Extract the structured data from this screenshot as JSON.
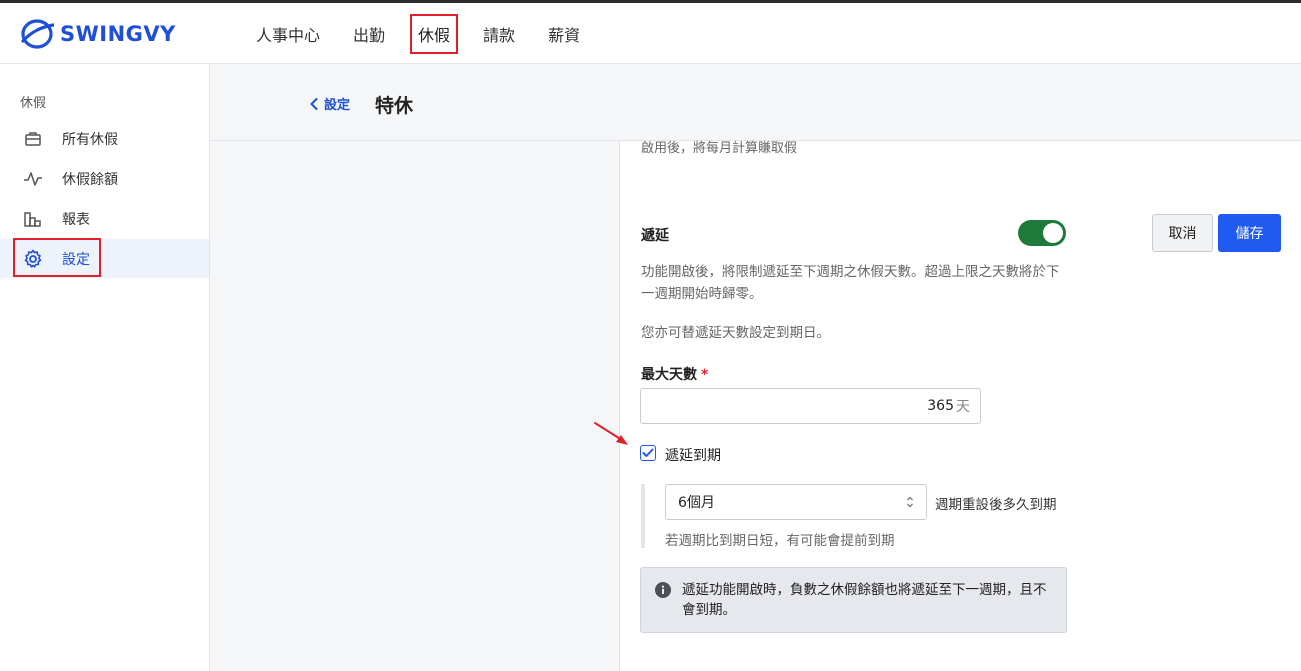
{
  "brand": {
    "name": "SWINGVY"
  },
  "nav": {
    "items": [
      {
        "label": "人事中心"
      },
      {
        "label": "出勤"
      },
      {
        "label": "休假",
        "active": true
      },
      {
        "label": "請款"
      },
      {
        "label": "薪資"
      }
    ]
  },
  "sidebar": {
    "title": "休假",
    "items": [
      {
        "label": "所有休假",
        "icon": "briefcase-icon"
      },
      {
        "label": "休假餘額",
        "icon": "activity-icon"
      },
      {
        "label": "報表",
        "icon": "bar-chart-icon"
      },
      {
        "label": "設定",
        "icon": "gear-icon",
        "active": true
      }
    ]
  },
  "header": {
    "back_label": "設定",
    "title": "特休"
  },
  "panel": {
    "cut_text": "啟用後，將每月計算賺取假",
    "carryover": {
      "label": "遞延",
      "toggle_on": true,
      "cancel_label": "取消",
      "save_label": "儲存",
      "description": "功能開啟後，將限制遞延至下週期之休假天數。超過上限之天數將於下一週期開始時歸零。",
      "description2": "您亦可替遞延天數設定到期日。"
    },
    "max_days": {
      "label": "最大天數",
      "required_mark": "*",
      "value": "365",
      "unit": "天"
    },
    "expiry": {
      "checkbox_label": "遞延到期",
      "checked": true,
      "select_value": "6個月",
      "select_after": "週期重設後多久到期",
      "hint": "若週期比到期日短，有可能會提前到期"
    },
    "info": {
      "text": "遞延功能開啟時，負數之休假餘額也將遞延至下一週期，且不會到期。"
    }
  },
  "colors": {
    "brand": "#1f4fd6",
    "primary": "#1f5bf0",
    "toggle_on": "#1e7a3a",
    "highlight": "#e0202a"
  }
}
